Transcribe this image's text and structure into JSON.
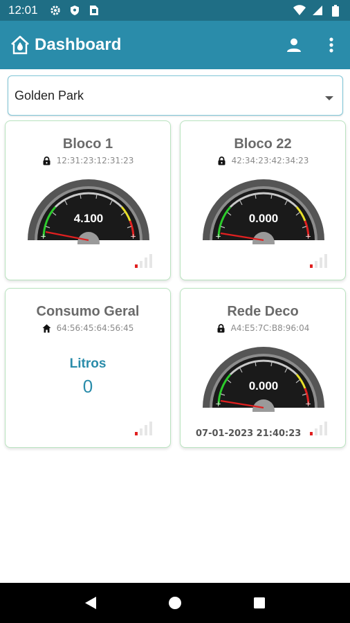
{
  "status_bar": {
    "time": "12:01",
    "icons_left": [
      "gear-icon",
      "shield-icon",
      "sim-icon"
    ],
    "icons_right": [
      "wifi-icon",
      "cell-signal-icon",
      "battery-icon"
    ]
  },
  "app_bar": {
    "title": "Dashboard",
    "actions": [
      "account-icon",
      "more-vert-icon"
    ]
  },
  "colors": {
    "status_bar": "#1f6e85",
    "app_bar": "#2a8caa",
    "accent": "#2a8caa",
    "card_border": "#b9e3bf",
    "needle": "#e02020"
  },
  "location_select": {
    "value": "Golden Park"
  },
  "cards": [
    {
      "title": "Bloco 1",
      "sub_icon": "lock-icon",
      "device_id": "12:31:23:12:31:23",
      "gauge_value": "4.100",
      "signal_level": 1
    },
    {
      "title": "Bloco 22",
      "sub_icon": "lock-icon",
      "device_id": "42:34:23:42:34:23",
      "gauge_value": "0.000",
      "signal_level": 1
    },
    {
      "title": "Consumo Geral",
      "sub_icon": "home-icon",
      "device_id": "64:56:45:64:56:45",
      "unit_label": "Litros",
      "total": "0",
      "signal_level": 1
    },
    {
      "title": "Rede Deco",
      "sub_icon": "lock-icon",
      "device_id": "A4:E5:7C:B8:96:04",
      "gauge_value": "0.000",
      "timestamp": "07-01-2023 21:40:23",
      "signal_level": 1
    }
  ],
  "nav_bar": {
    "buttons": [
      "back-icon",
      "home-icon",
      "recents-icon"
    ]
  }
}
